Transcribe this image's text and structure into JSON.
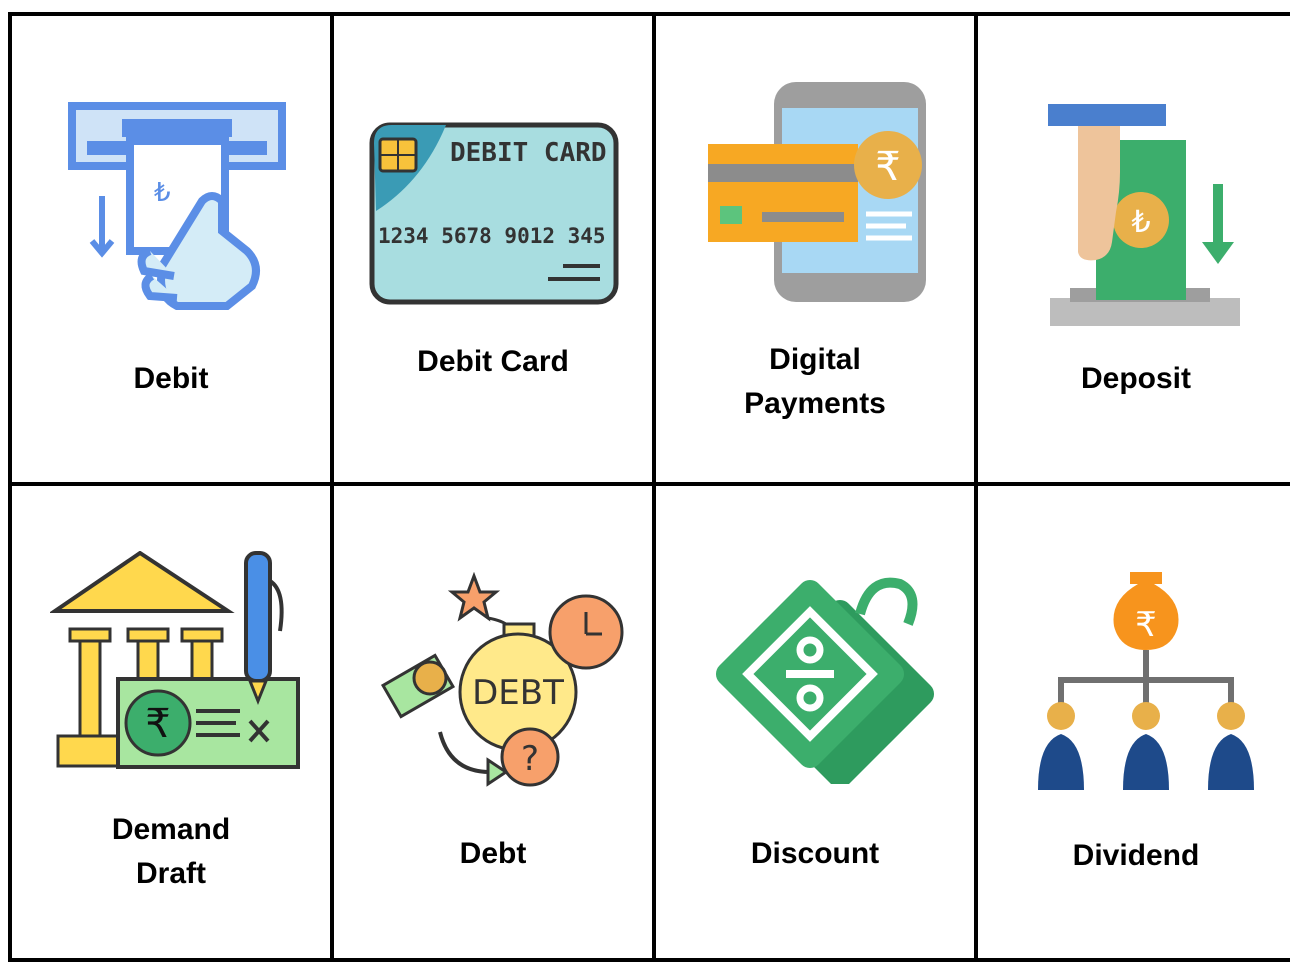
{
  "cards": [
    {
      "label": "Debit",
      "icon": "atm-withdraw-icon"
    },
    {
      "label": "Debit Card",
      "icon": "debit-card-icon",
      "card_text": "DEBIT CARD",
      "card_number": "1234 5678 9012 345"
    },
    {
      "label": "Digital\nPayments",
      "icon": "mobile-payment-icon"
    },
    {
      "label": "Deposit",
      "icon": "cash-deposit-icon"
    },
    {
      "label": "Demand\nDraft",
      "icon": "bank-cheque-icon"
    },
    {
      "label": "Debt",
      "icon": "debt-bomb-icon",
      "bomb_text": "DEBT"
    },
    {
      "label": "Discount",
      "icon": "discount-tag-icon"
    },
    {
      "label": "Dividend",
      "icon": "dividend-tree-icon"
    }
  ],
  "colors": {
    "border": "#000000",
    "blue": "#5b8ee6",
    "lightblue": "#d4ecf7",
    "green": "#3cae6c",
    "yellow": "#ffd84d",
    "orange": "#f7941d",
    "gold": "#e8b04a"
  }
}
